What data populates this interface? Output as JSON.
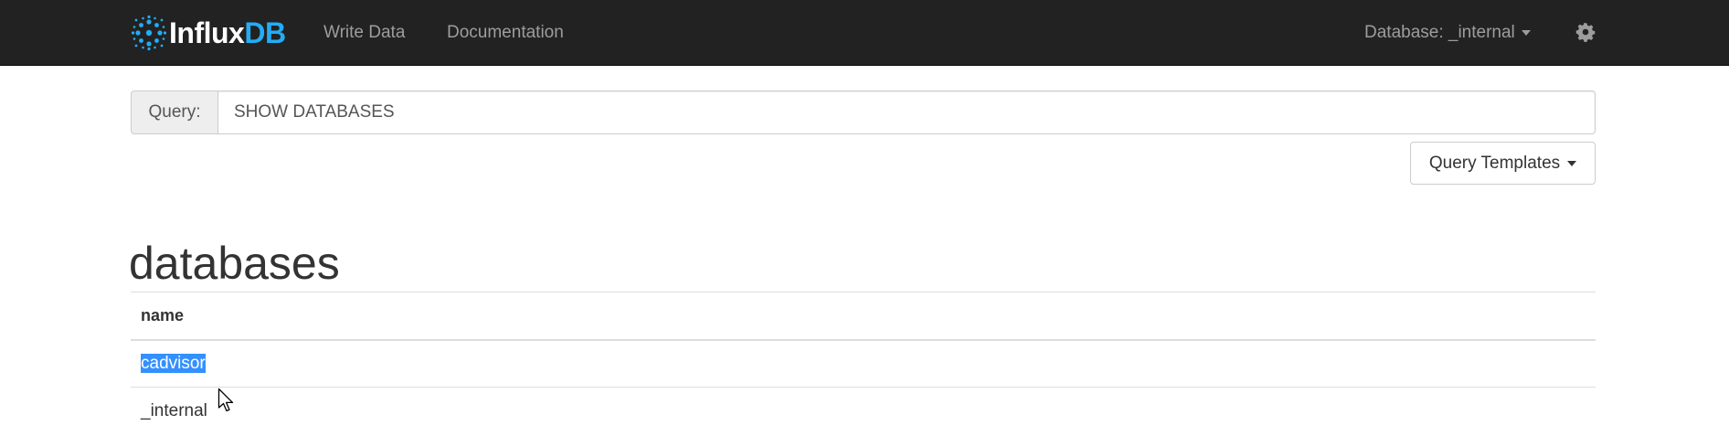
{
  "navbar": {
    "brand_part1": "Influx",
    "brand_part2": "DB",
    "links": [
      {
        "label": "Write Data"
      },
      {
        "label": "Documentation"
      }
    ],
    "database_label": "Database: _internal",
    "settings_icon": "gear-icon"
  },
  "query": {
    "label": "Query:",
    "value": "SHOW DATABASES",
    "templates_label": "Query Templates"
  },
  "results": {
    "title": "databases",
    "columns": [
      "name"
    ],
    "rows": [
      {
        "name": "cadvisor",
        "selected": true
      },
      {
        "name": "_internal",
        "selected": false
      }
    ]
  },
  "colors": {
    "navbar_bg": "#222222",
    "brand_accent": "#22adf6",
    "selection": "#3390ff"
  }
}
